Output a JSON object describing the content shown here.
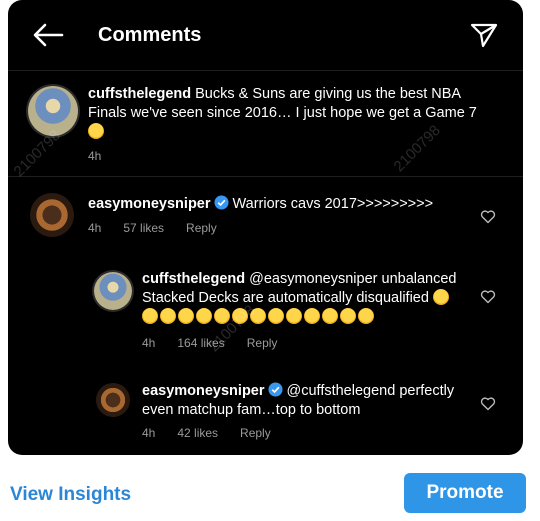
{
  "header": {
    "title": "Comments"
  },
  "caption": {
    "username": "cuffsthelegend",
    "text": "Bucks & Suns are giving us the best NBA Finals we've seen since 2016… I just hope we get a Game 7",
    "time": "4h"
  },
  "comments": [
    {
      "username": "easymoneysniper",
      "text": "Warriors cavs 2017>>>>>>>>>",
      "time": "4h",
      "likes": "57 likes",
      "reply": "Reply"
    },
    {
      "username": "cuffsthelegend",
      "text": "@easymoneysniper unbalanced Stacked Decks are automatically disqualified",
      "time": "4h",
      "likes": "164 likes",
      "reply": "Reply"
    },
    {
      "username": "easymoneysniper",
      "text": "@cuffsthelegend perfectly even matchup fam…top to bottom",
      "time": "4h",
      "likes": "42 likes",
      "reply": "Reply"
    }
  ],
  "footer": {
    "insights_label": "View Insights",
    "promote_label": "Promote"
  },
  "watermark": "2100798",
  "colors": {
    "accent": "#2f95e6",
    "link": "#2b86d6",
    "verified": "#3897f0",
    "background": "#000000"
  },
  "icons": [
    "back-arrow-icon",
    "send-icon",
    "heart-icon",
    "verified-badge-icon",
    "grimacing-emoji-icon",
    "laughing-emoji-icon"
  ]
}
